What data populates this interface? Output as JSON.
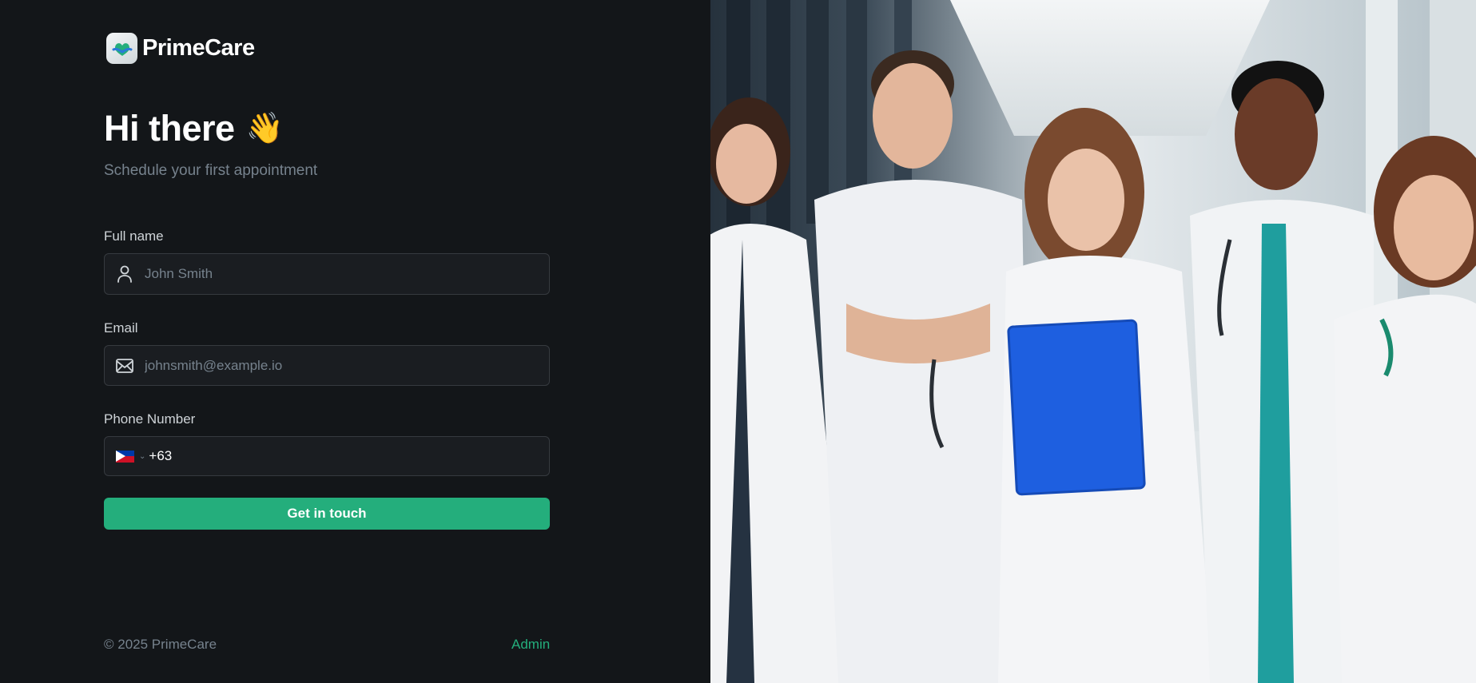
{
  "brand": {
    "name": "PrimeCare",
    "logo_icon": "heart-hands-icon"
  },
  "hero": {
    "title": "Hi there",
    "emoji": "👋",
    "subtitle": "Schedule your first appointment"
  },
  "form": {
    "full_name": {
      "label": "Full name",
      "placeholder": "John Smith",
      "icon": "user-icon"
    },
    "email": {
      "label": "Email",
      "placeholder": "johnsmith@example.io",
      "icon": "mail-icon"
    },
    "phone": {
      "label": "Phone Number",
      "country": "PH",
      "code": "+63"
    },
    "submit_label": "Get in touch"
  },
  "footer": {
    "copyright": "© 2025 PrimeCare",
    "admin_link": "Admin"
  },
  "colors": {
    "background": "#131619",
    "accent": "#24ae7c",
    "muted": "#76828d",
    "input_bg": "#1a1d21",
    "input_border": "#363a3f"
  },
  "image": {
    "alt": "Group of doctors in white coats with stethoscopes smiling in a hospital corridor"
  }
}
